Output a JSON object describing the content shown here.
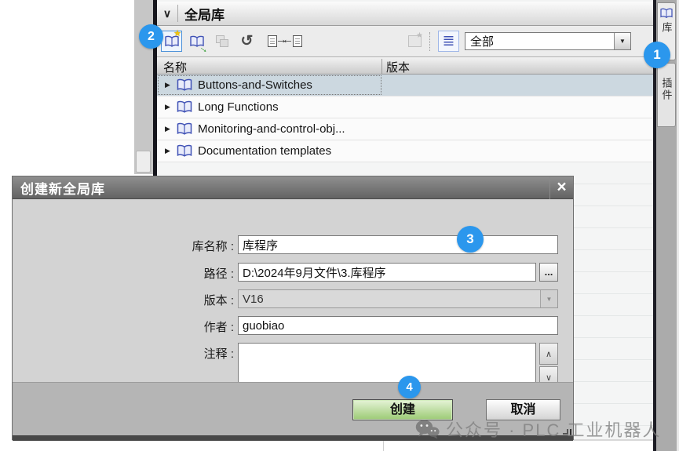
{
  "panel": {
    "title": "全局库",
    "toolbar": {
      "filter_value": "全部",
      "icon_names": [
        "create-new-global-library",
        "open-global-library",
        "save-library",
        "update-library",
        "export-library",
        "import-library",
        "create-version",
        "detail-list-view",
        "filter-dropdown"
      ]
    },
    "columns": {
      "name": "名称",
      "version": "版本"
    },
    "rows": [
      {
        "label": "Buttons-and-Switches"
      },
      {
        "label": "Long Functions"
      },
      {
        "label": "Monitoring-and-control-obj..."
      },
      {
        "label": "Documentation templates"
      }
    ]
  },
  "side_tabs": [
    {
      "label": "库"
    },
    {
      "label": "插件"
    }
  ],
  "dialog": {
    "title": "创建新全局库",
    "fields": {
      "name": {
        "label": "库名称 :",
        "value": "库程序"
      },
      "path": {
        "label": "路径 :",
        "value": "D:\\2024年9月文件\\3.库程序",
        "browse": "..."
      },
      "version": {
        "label": "版本 :",
        "value": "V16"
      },
      "author": {
        "label": "作者 :",
        "value": "guobiao"
      },
      "comment": {
        "label": "注释 :",
        "value": ""
      }
    },
    "buttons": {
      "create": "创建",
      "cancel": "取消"
    }
  },
  "annotations": [
    "1",
    "2",
    "3",
    "4"
  ],
  "watermark": {
    "text": "公众号 · PLC 工业机器人"
  },
  "glyphs": {
    "chevron_down": "∨",
    "expander": "▶",
    "dropdown_arrow": "▼",
    "close": "×",
    "star": "★",
    "green_arrow": "→",
    "rotate": "↺",
    "arrow_right": "→",
    "arrow_left": "←",
    "list": "≣",
    "up": "∧",
    "down": "∨",
    "browse": "..."
  },
  "colors": {
    "accent_blue": "#2b97ed",
    "create_green": "#9ccb75",
    "selected_row": "#ccd8e0"
  }
}
